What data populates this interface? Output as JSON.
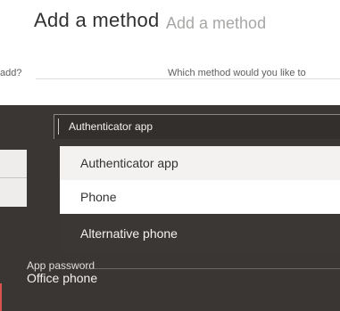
{
  "header": {
    "title": "Add a method",
    "title_ghost": "Add a method"
  },
  "prompt": {
    "left_fragment": "add?",
    "question": "Which method would you like to"
  },
  "dropdown": {
    "selected_value": "Authenticator app"
  },
  "options": [
    {
      "label": "Authenticator app"
    },
    {
      "label": "Phone"
    },
    {
      "label": "Alternative phone"
    }
  ],
  "partial_items": {
    "app_password": "App password",
    "office_phone": "Office phone"
  },
  "colors": {
    "dark_surface": "#3a3634",
    "hover_option": "#f3f2f1",
    "white_option": "#ffffff",
    "text": "#323130"
  }
}
